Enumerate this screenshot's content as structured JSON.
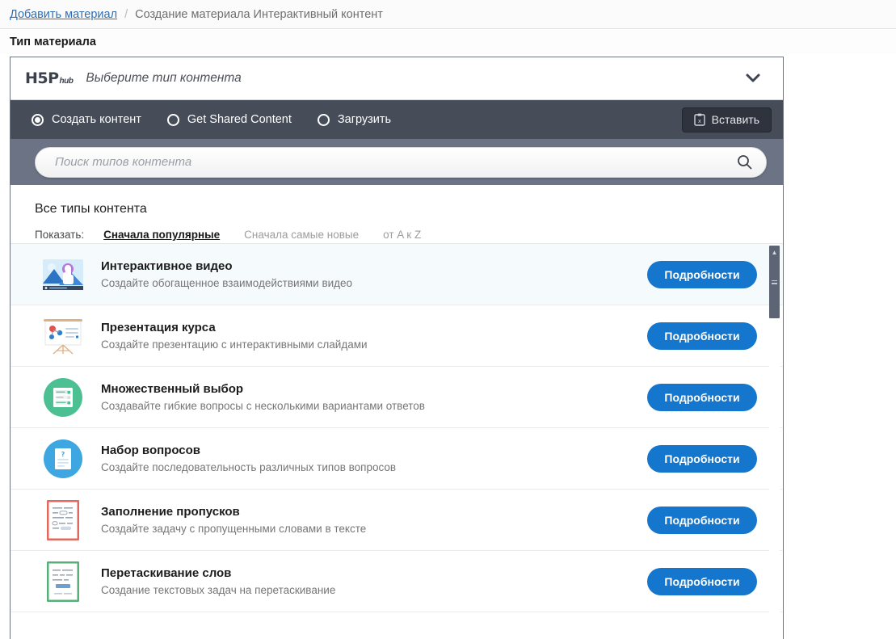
{
  "breadcrumb": {
    "link_label": "Добавить материал",
    "separator": "/",
    "current_label": "Создание материала Интерактивный контент"
  },
  "page_heading": "Тип материала",
  "h5p": {
    "logo_main": "H5P",
    "logo_sub": "hub",
    "header_title": "Выберите тип контента",
    "collapse_icon": "chevron-down-icon",
    "toolbar": {
      "options": [
        {
          "label": "Создать контент",
          "checked": true
        },
        {
          "label": "Get Shared Content",
          "checked": false
        },
        {
          "label": "Загрузить",
          "checked": false
        }
      ],
      "paste_label": "Вставить",
      "paste_icon": "clipboard-icon",
      "background": "#464d59"
    },
    "search": {
      "placeholder": "Поиск типов контента",
      "value": "",
      "icon": "search-icon",
      "band_background": "#6b7384"
    },
    "section_title": "Все типы контента",
    "sort": {
      "label": "Показать:",
      "options": [
        {
          "label": "Сначала популярные",
          "active": true
        },
        {
          "label": "Сначала самые новые",
          "active": false
        },
        {
          "label": "от A к Z",
          "active": false
        }
      ]
    },
    "details_label": "Подробности",
    "accent_color": "#1476cd",
    "content_types": [
      {
        "title": "Интерактивное видео",
        "description": "Создайте обогащенное взаимодействиями видео",
        "icon": "interactive-video-icon",
        "selected": true
      },
      {
        "title": "Презентация курса",
        "description": "Создайте презентацию с интерактивными слайдами",
        "icon": "course-presentation-icon",
        "selected": false
      },
      {
        "title": "Множественный выбор",
        "description": "Создавайте гибкие вопросы с несколькими вариантами ответов",
        "icon": "multiple-choice-icon",
        "selected": false
      },
      {
        "title": "Набор вопросов",
        "description": "Создайте последовательность различных типов вопросов",
        "icon": "question-set-icon",
        "selected": false
      },
      {
        "title": "Заполнение пропусков",
        "description": "Создайте задачу с пропущенными словами в тексте",
        "icon": "fill-in-the-blanks-icon",
        "selected": false
      },
      {
        "title": "Перетаскивание слов",
        "description": "Создание текстовых задач на перетаскивание",
        "icon": "drag-the-words-icon",
        "selected": false
      }
    ]
  }
}
